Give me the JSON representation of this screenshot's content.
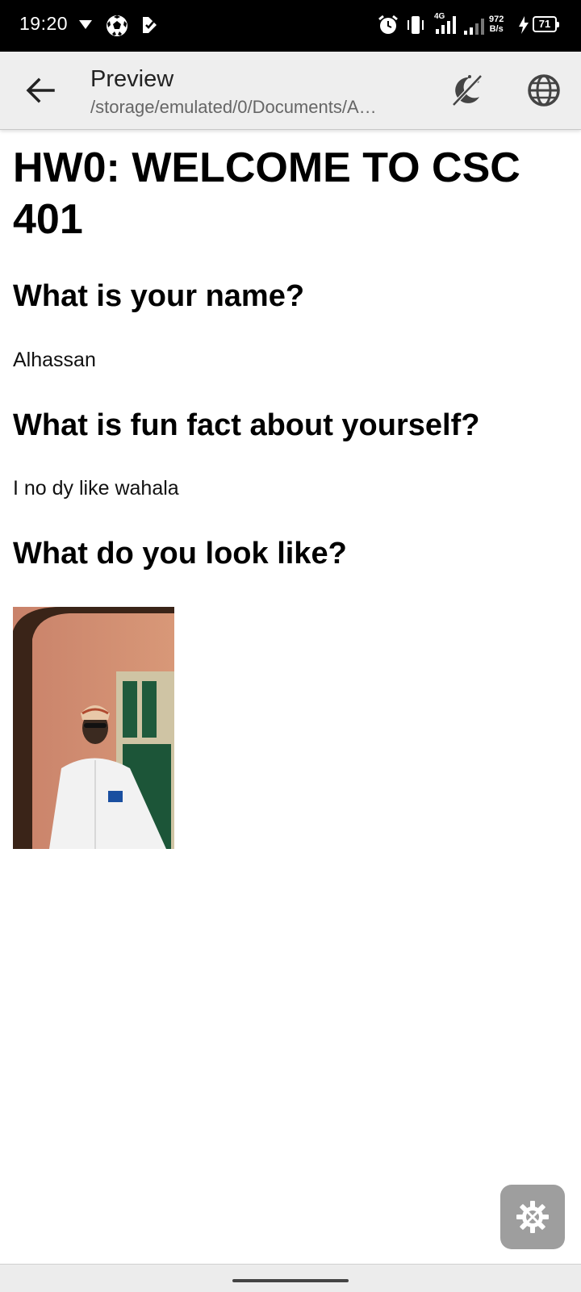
{
  "status_bar": {
    "time": "19:20",
    "network_speed_value": "972",
    "network_speed_unit": "B/s",
    "network_type": "4G",
    "battery_level": "71",
    "icons": [
      "notification-dropdown-icon",
      "football-icon",
      "app-notification-icon",
      "alarm-icon",
      "vibrate-icon",
      "signal-icon",
      "signal-weak-icon",
      "charging-icon",
      "battery-icon"
    ]
  },
  "app_bar": {
    "title": "Preview",
    "subtitle": "/storage/emulated/0/Documents/A…",
    "icons": [
      "back-arrow-icon",
      "night-mode-icon",
      "globe-icon"
    ]
  },
  "document": {
    "heading": "HW0: WELCOME TO CSC 401",
    "q1": "What is your name?",
    "a1": "Alhassan",
    "q2": "What is fun fact about yourself?",
    "a2": "I no dy like wahala",
    "q3": "What do you look like?"
  },
  "fab": {
    "icon": "settings-icon"
  },
  "colors": {
    "status_bar_bg": "#000000",
    "app_bar_bg": "#eeeeee",
    "fab_bg": "#9e9e9e"
  }
}
